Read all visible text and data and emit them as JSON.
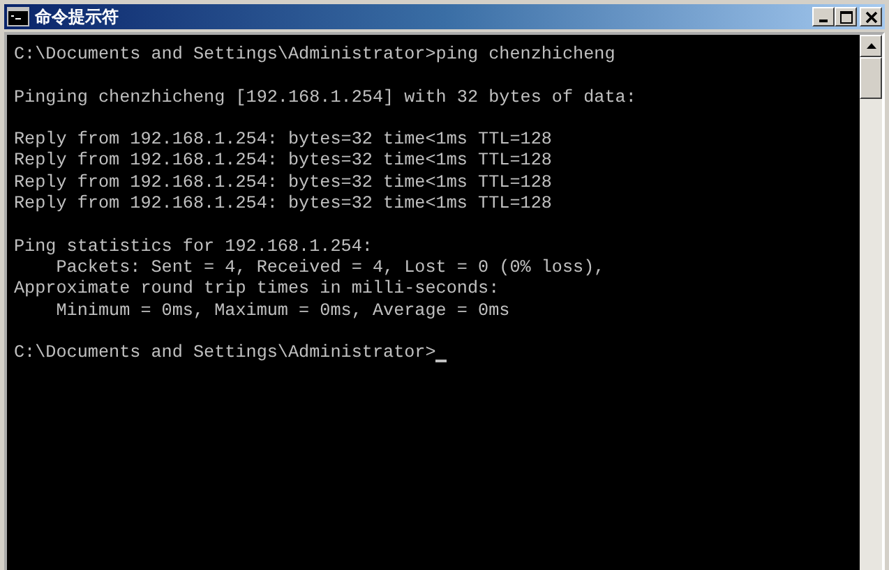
{
  "window": {
    "title": "命令提示符"
  },
  "console": {
    "blocks": [
      [
        "C:\\Documents and Settings\\Administrator>ping chenzhicheng"
      ],
      [
        "Pinging chenzhicheng [192.168.1.254] with 32 bytes of data:"
      ],
      [
        "Reply from 192.168.1.254: bytes=32 time<1ms TTL=128",
        "Reply from 192.168.1.254: bytes=32 time<1ms TTL=128",
        "Reply from 192.168.1.254: bytes=32 time<1ms TTL=128",
        "Reply from 192.168.1.254: bytes=32 time<1ms TTL=128"
      ],
      [
        "Ping statistics for 192.168.1.254:",
        "    Packets: Sent = 4, Received = 4, Lost = 0 (0% loss),",
        "Approximate round trip times in milli-seconds:",
        "    Minimum = 0ms, Maximum = 0ms, Average = 0ms"
      ],
      [
        "C:\\Documents and Settings\\Administrator>"
      ]
    ],
    "cursor_visible": true
  }
}
